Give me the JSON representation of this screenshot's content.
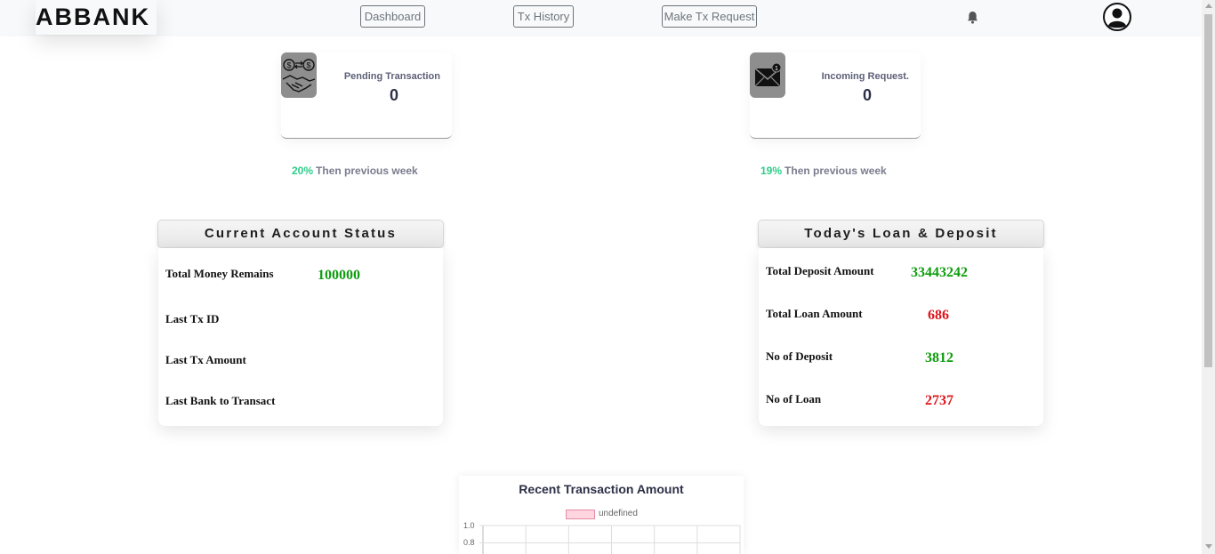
{
  "brand": "ABBANK",
  "nav": {
    "dashboard": "Dashboard",
    "tx_history": "Tx History",
    "make_request": "Make Tx Request"
  },
  "cards": {
    "pending": {
      "title": "Pending Transaction",
      "value": "0",
      "pct": "20%",
      "note": "Then previous week",
      "icon": "handshake-icon"
    },
    "incoming": {
      "title": "Incoming Request.",
      "value": "0",
      "pct": "19%",
      "note": "Then previous week",
      "icon": "envelope-icon"
    }
  },
  "account": {
    "title": "Current Account Status",
    "rows": [
      {
        "label": "Total Money Remains",
        "value": "100000"
      },
      {
        "label": "Last Tx ID",
        "value": ""
      },
      {
        "label": "Last Tx Amount",
        "value": ""
      },
      {
        "label": "Last Bank to Transact",
        "value": ""
      }
    ]
  },
  "loan": {
    "title": "Today's Loan & Deposit",
    "rows": [
      {
        "label": "Total Deposit Amount",
        "value": "33443242"
      },
      {
        "label": "Total Loan Amount",
        "value": "686"
      },
      {
        "label": "No of Deposit",
        "value": "3812"
      },
      {
        "label": "No of Loan",
        "value": "2737"
      }
    ]
  },
  "colors": {
    "positive": "#0f9d0f",
    "negative": "#e0141b",
    "growth": "#2dce89"
  },
  "chart_data": {
    "type": "bar",
    "title": "Recent Transaction Amount",
    "series": [
      {
        "name": "undefined",
        "values": []
      }
    ],
    "yticks": [
      "1.0",
      "0.8"
    ],
    "ylim": [
      0,
      1.0
    ],
    "grid": true,
    "legend": "top"
  }
}
